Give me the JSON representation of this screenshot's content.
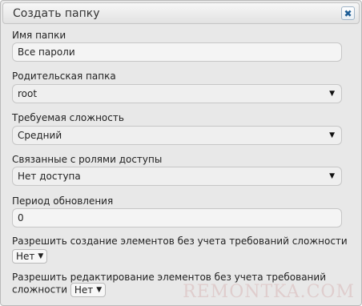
{
  "dialog": {
    "title": "Создать папку",
    "close_icon": "close-icon"
  },
  "form": {
    "folder_name": {
      "label": "Имя папки",
      "value": "Все пароли"
    },
    "parent_folder": {
      "label": "Родительская папка",
      "value": "root"
    },
    "complexity": {
      "label": "Требуемая сложность",
      "value": "Средний"
    },
    "role_access": {
      "label": "Связанные с ролями доступы",
      "value": "Нет доступа"
    },
    "renewal_period": {
      "label": "Период обновления",
      "value": "0"
    },
    "allow_create": {
      "label": "Разрешить создание элементов без учета требований сложности",
      "value": "Нет"
    },
    "allow_edit": {
      "label_line1": "Разрешить редактирование элементов без учета требований",
      "label_line2": "сложности",
      "value": "Нет"
    }
  },
  "watermark": "REMONTKA.COM",
  "icons": {
    "dropdown": "triangle-down-icon",
    "close": "close-icon"
  },
  "colors": {
    "dialog_bg": "#e8e8e8",
    "field_bg": "#f4f4f4",
    "close_icon": "#1c5d96"
  }
}
